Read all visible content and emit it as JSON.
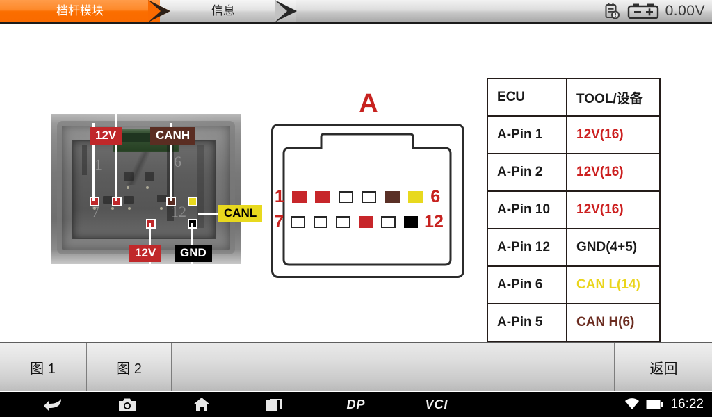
{
  "statusbar": {
    "tabs": [
      {
        "label": "档杆模块",
        "active": true
      },
      {
        "label": "信息",
        "active": false
      }
    ],
    "report_icon": "report-clipboard-icon",
    "battery_icon": "battery-terminal-icon",
    "voltage": "0.00V"
  },
  "photo": {
    "alt": "gear-shift-module-connector-photo",
    "pin_numbers": {
      "p1": "1",
      "p6": "6",
      "p7": "7",
      "p12": "12"
    },
    "callouts": [
      {
        "id": "12v-top-left",
        "label": "12V",
        "bg": "#c0282a",
        "fg": "#ffffff"
      },
      {
        "id": "canh",
        "label": "CANH",
        "bg": "#5a2d22",
        "fg": "#ffffff"
      },
      {
        "id": "canl",
        "label": "CANL",
        "bg": "#e8d91e",
        "fg": "#000000"
      },
      {
        "id": "12v-bottom",
        "label": "12V",
        "bg": "#c0282a",
        "fg": "#ffffff"
      },
      {
        "id": "gnd",
        "label": "GND",
        "bg": "#000000",
        "fg": "#ffffff"
      }
    ],
    "markers": [
      {
        "id": "marker-12v-a",
        "color": "#c0282a"
      },
      {
        "id": "marker-12v-b",
        "color": "#c0282a"
      },
      {
        "id": "marker-canh",
        "color": "#5a2d22"
      },
      {
        "id": "marker-canl",
        "color": "#e8d91e"
      },
      {
        "id": "marker-12v-c",
        "color": "#c0282a"
      },
      {
        "id": "marker-gnd",
        "color": "#000000"
      }
    ]
  },
  "schematic": {
    "title": "A",
    "title_color": "#c7221f",
    "row1": {
      "start_label": "1",
      "end_label": "6",
      "pins": [
        {
          "pin": 1,
          "color": "#c7262a"
        },
        {
          "pin": 2,
          "color": "#c7262a"
        },
        {
          "pin": 3,
          "color": "#ffffff"
        },
        {
          "pin": 4,
          "color": "#ffffff"
        },
        {
          "pin": 5,
          "color": "#5a3026"
        },
        {
          "pin": 6,
          "color": "#e8d91e"
        }
      ]
    },
    "row2": {
      "start_label": "7",
      "end_label": "12",
      "pins": [
        {
          "pin": 7,
          "color": "#ffffff"
        },
        {
          "pin": 8,
          "color": "#ffffff"
        },
        {
          "pin": 9,
          "color": "#ffffff"
        },
        {
          "pin": 10,
          "color": "#c7262a"
        },
        {
          "pin": 11,
          "color": "#ffffff"
        },
        {
          "pin": 12,
          "color": "#000000"
        }
      ]
    }
  },
  "table": {
    "headers": [
      "ECU",
      "TOOL/设备"
    ],
    "rows": [
      {
        "ecu": "A-Pin 1",
        "tool": "12V(16)",
        "tool_color": "#cc1f1f"
      },
      {
        "ecu": "A-Pin 2",
        "tool": "12V(16)",
        "tool_color": "#cc1f1f"
      },
      {
        "ecu": "A-Pin 10",
        "tool": "12V(16)",
        "tool_color": "#cc1f1f"
      },
      {
        "ecu": "A-Pin 12",
        "tool": "GND(4+5)",
        "tool_color": "#1a1a1a"
      },
      {
        "ecu": "A-Pin 6",
        "tool": "CAN L(14)",
        "tool_color": "#ead51c"
      },
      {
        "ecu": "A-Pin 5",
        "tool": "CAN H(6)",
        "tool_color": "#6b2c20"
      }
    ]
  },
  "toolbar": {
    "buttons": [
      {
        "id": "fig1",
        "label": "图 1"
      },
      {
        "id": "fig2",
        "label": "图 2"
      }
    ],
    "back_label": "返回"
  },
  "navbar": {
    "icons": [
      "back-arrow-icon",
      "camera-icon",
      "home-icon",
      "recent-apps-icon"
    ],
    "brand": "DP",
    "vci": "VCI",
    "wifi_icon": "wifi-icon",
    "battery_icon": "battery-icon",
    "clock": "16:22"
  }
}
